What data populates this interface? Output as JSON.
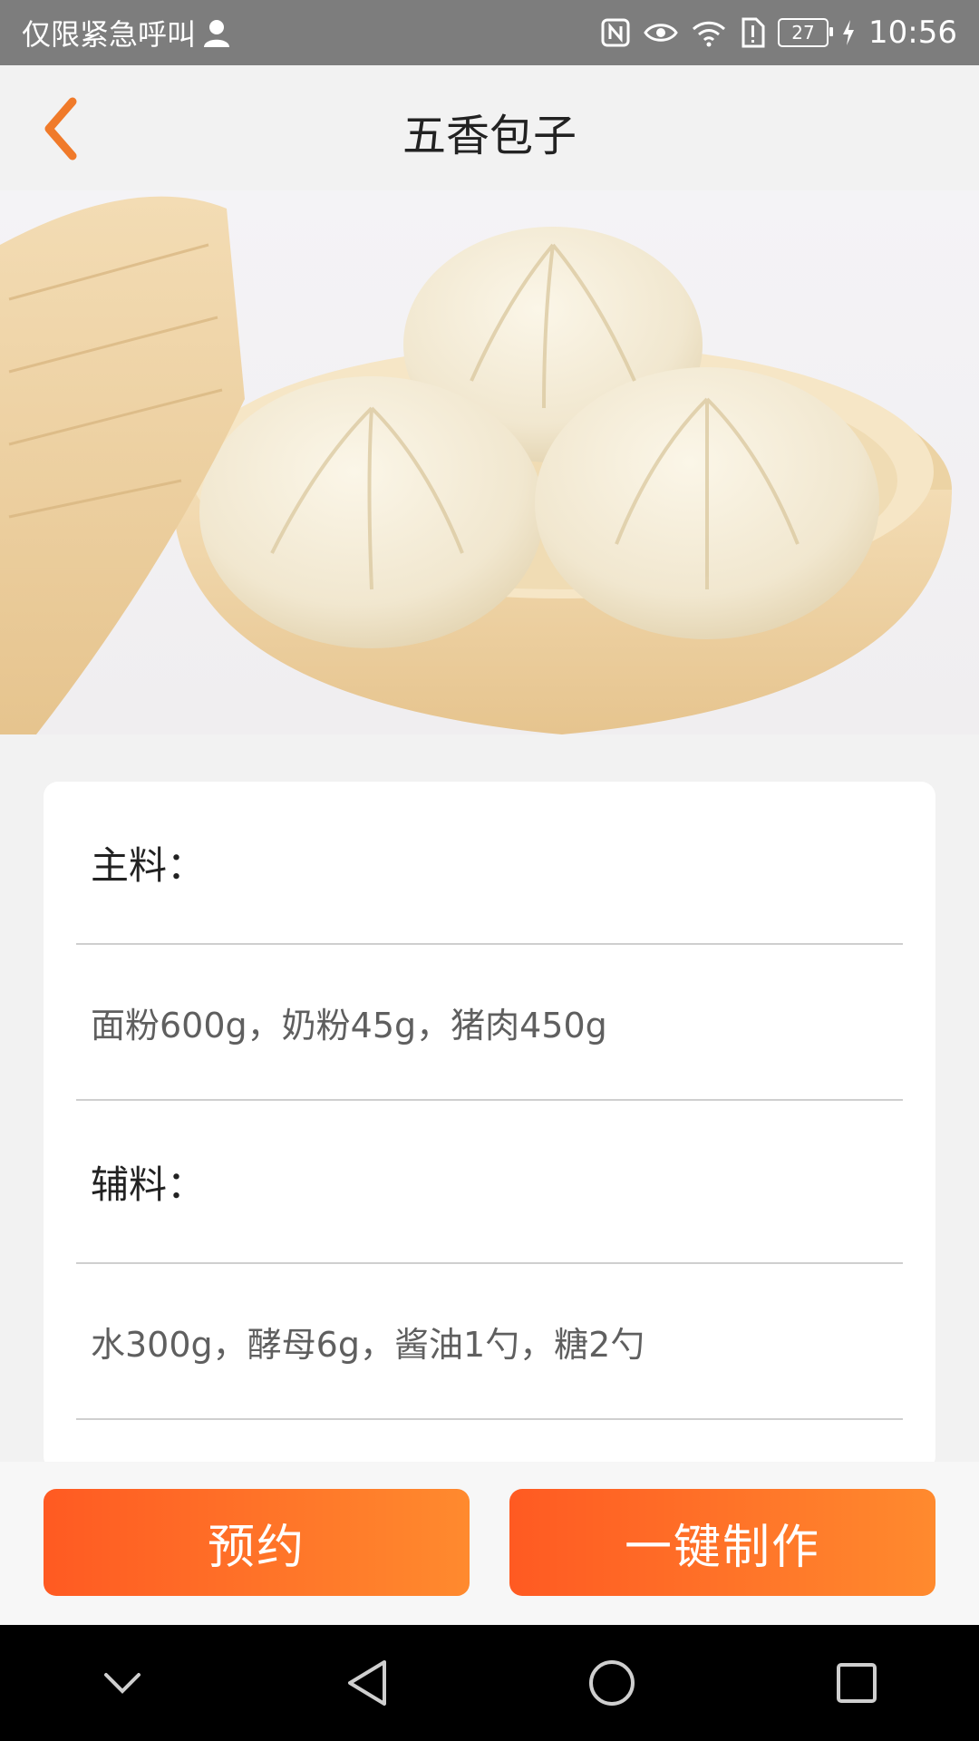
{
  "status_bar": {
    "carrier_text": "仅限紧急呼叫",
    "battery_level": "27",
    "time": "10:56",
    "icons": [
      "person-icon",
      "nfc-icon",
      "eye-icon",
      "wifi-icon",
      "sim-alert-icon",
      "battery-icon",
      "charging-icon"
    ]
  },
  "header": {
    "title": "五香包子",
    "back_icon": "chevron-left-icon"
  },
  "hero": {
    "image": "steamed-buns-in-bamboo-steamer"
  },
  "recipe": {
    "main_title": "主料：",
    "main_items": "面粉600g，奶粉45g，猪肉450g",
    "sub_title": "辅料：",
    "sub_items": "水300g，酵母6g，酱油1勺，糖2勺"
  },
  "actions": {
    "reserve_label": "预约",
    "make_label": "一键制作"
  },
  "system_nav": {
    "icons": [
      "chevron-down-icon",
      "back-triangle-icon",
      "home-circle-icon",
      "recents-square-icon"
    ]
  },
  "colors": {
    "accent": "#ff5a22",
    "accent_end": "#ff8a2e",
    "back_arrow": "#f07a2a",
    "status_bar": "#7d7d7d"
  }
}
